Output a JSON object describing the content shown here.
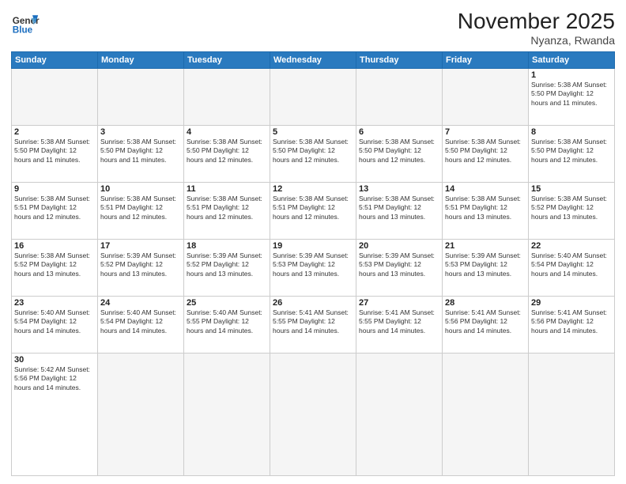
{
  "header": {
    "logo_general": "General",
    "logo_blue": "Blue",
    "title": "November 2025",
    "subtitle": "Nyanza, Rwanda"
  },
  "days_of_week": [
    "Sunday",
    "Monday",
    "Tuesday",
    "Wednesday",
    "Thursday",
    "Friday",
    "Saturday"
  ],
  "weeks": [
    [
      {
        "day": "",
        "info": "",
        "empty": true
      },
      {
        "day": "",
        "info": "",
        "empty": true
      },
      {
        "day": "",
        "info": "",
        "empty": true
      },
      {
        "day": "",
        "info": "",
        "empty": true
      },
      {
        "day": "",
        "info": "",
        "empty": true
      },
      {
        "day": "",
        "info": "",
        "empty": true
      },
      {
        "day": "1",
        "info": "Sunrise: 5:38 AM\nSunset: 5:50 PM\nDaylight: 12 hours\nand 11 minutes."
      }
    ],
    [
      {
        "day": "2",
        "info": "Sunrise: 5:38 AM\nSunset: 5:50 PM\nDaylight: 12 hours\nand 11 minutes."
      },
      {
        "day": "3",
        "info": "Sunrise: 5:38 AM\nSunset: 5:50 PM\nDaylight: 12 hours\nand 11 minutes."
      },
      {
        "day": "4",
        "info": "Sunrise: 5:38 AM\nSunset: 5:50 PM\nDaylight: 12 hours\nand 12 minutes."
      },
      {
        "day": "5",
        "info": "Sunrise: 5:38 AM\nSunset: 5:50 PM\nDaylight: 12 hours\nand 12 minutes."
      },
      {
        "day": "6",
        "info": "Sunrise: 5:38 AM\nSunset: 5:50 PM\nDaylight: 12 hours\nand 12 minutes."
      },
      {
        "day": "7",
        "info": "Sunrise: 5:38 AM\nSunset: 5:50 PM\nDaylight: 12 hours\nand 12 minutes."
      },
      {
        "day": "8",
        "info": "Sunrise: 5:38 AM\nSunset: 5:50 PM\nDaylight: 12 hours\nand 12 minutes."
      }
    ],
    [
      {
        "day": "9",
        "info": "Sunrise: 5:38 AM\nSunset: 5:51 PM\nDaylight: 12 hours\nand 12 minutes."
      },
      {
        "day": "10",
        "info": "Sunrise: 5:38 AM\nSunset: 5:51 PM\nDaylight: 12 hours\nand 12 minutes."
      },
      {
        "day": "11",
        "info": "Sunrise: 5:38 AM\nSunset: 5:51 PM\nDaylight: 12 hours\nand 12 minutes."
      },
      {
        "day": "12",
        "info": "Sunrise: 5:38 AM\nSunset: 5:51 PM\nDaylight: 12 hours\nand 12 minutes."
      },
      {
        "day": "13",
        "info": "Sunrise: 5:38 AM\nSunset: 5:51 PM\nDaylight: 12 hours\nand 13 minutes."
      },
      {
        "day": "14",
        "info": "Sunrise: 5:38 AM\nSunset: 5:51 PM\nDaylight: 12 hours\nand 13 minutes."
      },
      {
        "day": "15",
        "info": "Sunrise: 5:38 AM\nSunset: 5:52 PM\nDaylight: 12 hours\nand 13 minutes."
      }
    ],
    [
      {
        "day": "16",
        "info": "Sunrise: 5:38 AM\nSunset: 5:52 PM\nDaylight: 12 hours\nand 13 minutes."
      },
      {
        "day": "17",
        "info": "Sunrise: 5:39 AM\nSunset: 5:52 PM\nDaylight: 12 hours\nand 13 minutes."
      },
      {
        "day": "18",
        "info": "Sunrise: 5:39 AM\nSunset: 5:52 PM\nDaylight: 12 hours\nand 13 minutes."
      },
      {
        "day": "19",
        "info": "Sunrise: 5:39 AM\nSunset: 5:53 PM\nDaylight: 12 hours\nand 13 minutes."
      },
      {
        "day": "20",
        "info": "Sunrise: 5:39 AM\nSunset: 5:53 PM\nDaylight: 12 hours\nand 13 minutes."
      },
      {
        "day": "21",
        "info": "Sunrise: 5:39 AM\nSunset: 5:53 PM\nDaylight: 12 hours\nand 13 minutes."
      },
      {
        "day": "22",
        "info": "Sunrise: 5:40 AM\nSunset: 5:54 PM\nDaylight: 12 hours\nand 14 minutes."
      }
    ],
    [
      {
        "day": "23",
        "info": "Sunrise: 5:40 AM\nSunset: 5:54 PM\nDaylight: 12 hours\nand 14 minutes."
      },
      {
        "day": "24",
        "info": "Sunrise: 5:40 AM\nSunset: 5:54 PM\nDaylight: 12 hours\nand 14 minutes."
      },
      {
        "day": "25",
        "info": "Sunrise: 5:40 AM\nSunset: 5:55 PM\nDaylight: 12 hours\nand 14 minutes."
      },
      {
        "day": "26",
        "info": "Sunrise: 5:41 AM\nSunset: 5:55 PM\nDaylight: 12 hours\nand 14 minutes."
      },
      {
        "day": "27",
        "info": "Sunrise: 5:41 AM\nSunset: 5:55 PM\nDaylight: 12 hours\nand 14 minutes."
      },
      {
        "day": "28",
        "info": "Sunrise: 5:41 AM\nSunset: 5:56 PM\nDaylight: 12 hours\nand 14 minutes."
      },
      {
        "day": "29",
        "info": "Sunrise: 5:41 AM\nSunset: 5:56 PM\nDaylight: 12 hours\nand 14 minutes."
      }
    ],
    [
      {
        "day": "30",
        "info": "Sunrise: 5:42 AM\nSunset: 5:56 PM\nDaylight: 12 hours\nand 14 minutes."
      },
      {
        "day": "",
        "info": "",
        "empty": true
      },
      {
        "day": "",
        "info": "",
        "empty": true
      },
      {
        "day": "",
        "info": "",
        "empty": true
      },
      {
        "day": "",
        "info": "",
        "empty": true
      },
      {
        "day": "",
        "info": "",
        "empty": true
      },
      {
        "day": "",
        "info": "",
        "empty": true
      }
    ]
  ]
}
